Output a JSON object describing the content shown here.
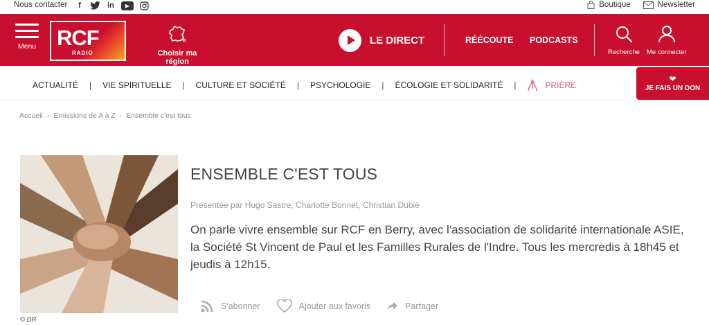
{
  "topbar": {
    "contact": "Nous contacter",
    "social": [
      {
        "icon": "facebook-icon",
        "glyph": "f"
      },
      {
        "icon": "twitter-icon",
        "glyph": "🐦"
      },
      {
        "icon": "linkedin-icon",
        "glyph": "in"
      },
      {
        "icon": "youtube-icon",
        "glyph": "▶"
      },
      {
        "icon": "instagram-icon",
        "glyph": "◎"
      }
    ],
    "boutique": "Boutique",
    "newsletter": "Newsletter"
  },
  "header": {
    "menu_label": "Menu",
    "logo_text": "RCF",
    "logo_sub": "RADIO",
    "region_label": "Choisir ma région",
    "direct_label": "LE DIRECT",
    "reecoute": "RÉÉCOUTE",
    "podcasts": "PODCASTS",
    "search_label": "Recherche",
    "account_label": "Me connecter",
    "brand_color": "#c8102e"
  },
  "catnav": {
    "items": [
      "ACTUALITÉ",
      "VIE SPIRITUELLE",
      "CULTURE ET SOCIÉTÉ",
      "PSYCHOLOGIE",
      "ÉCOLOGIE ET SOLIDARITÉ"
    ],
    "separator": "|",
    "priere": "PRIÈRE",
    "don_label": "JE FAIS UN DON"
  },
  "breadcrumb": [
    "Accueil",
    "Emissions de A à Z",
    "Ensemble c'est tous"
  ],
  "show": {
    "title": "ENSEMBLE C'EST TOUS",
    "presenters": "Présentée par Hugo Sastre, Charlotte Bonnet, Christian Dubié",
    "description": "On parle vivre ensemble sur RCF en Berry, avec l'association de solidarité internationale ASIE, la Société St Vincent de Paul et les Familles Rurales de l'Indre. Tous les mercredis à 18h45 et jeudis à 12h15.",
    "image_credit": "© DR",
    "subscribe": "S'abonner",
    "favorite": "Ajouter aux favoris",
    "share": "Partager"
  }
}
